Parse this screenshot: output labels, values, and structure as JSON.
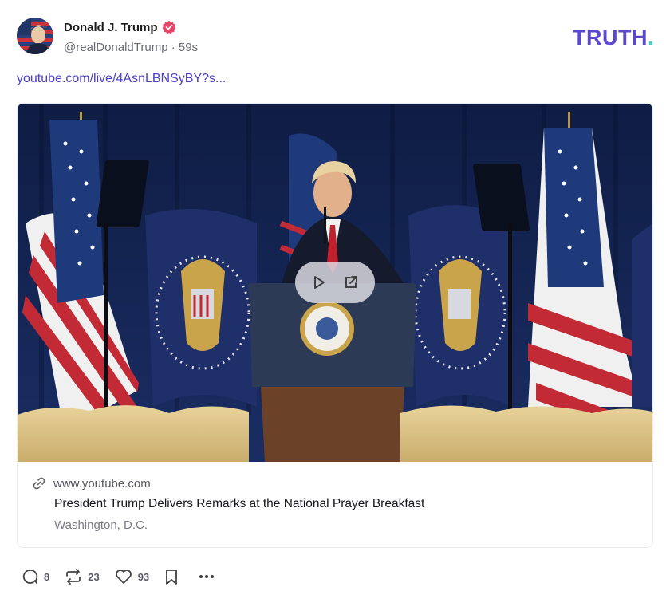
{
  "post": {
    "author": {
      "display_name": "Donald J. Trump",
      "handle": "@realDonaldTrump",
      "separator": "·",
      "time": "59s",
      "verified": true,
      "verified_color": "#e8456a"
    },
    "brand": {
      "logo_text": "TRUTH",
      "logo_dot": ".",
      "logo_color": "#5b48d0",
      "dot_color": "#3ad4c4"
    },
    "link_text": "youtube.com/live/4AsnLBNSyBY?s...",
    "link_color": "#4a3fc6",
    "card": {
      "thumbnail_icon": "video-thumbnail",
      "play_icon": "play-icon",
      "open_icon": "external-link-icon",
      "domain_icon": "link-icon",
      "domain": "www.youtube.com",
      "title": "President Trump Delivers Remarks at the National Prayer Breakfast",
      "description": "Washington, D.C."
    },
    "actions": {
      "reply_icon": "reply-icon",
      "reply_count": "8",
      "retruth_icon": "retruth-icon",
      "retruth_count": "23",
      "like_icon": "heart-icon",
      "like_count": "93",
      "bookmark_icon": "bookmark-icon",
      "more_icon": "more-icon"
    }
  }
}
